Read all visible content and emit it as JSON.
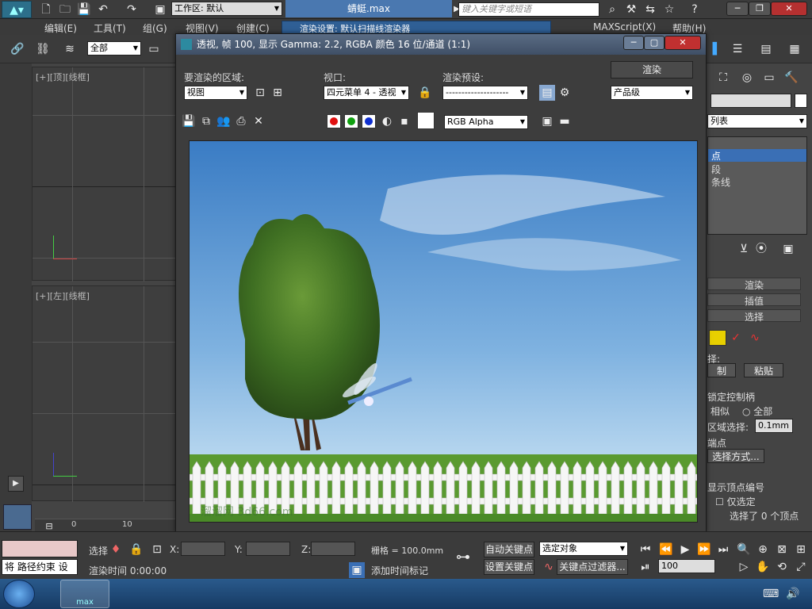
{
  "app": {
    "workspace_label": "工作区: 默认",
    "file_title": "蜻蜓.max",
    "search_placeholder": "键入关键字或短语"
  },
  "menu": [
    "编辑(E)",
    "工具(T)",
    "组(G)",
    "视图(V)",
    "创建(C)",
    "MAXScript(X)",
    "帮助(H)"
  ],
  "toolbar": {
    "selection_filter": "全部"
  },
  "background_dialog_title": "渲染设置: 默认扫描线渲染器",
  "viewports": {
    "top_label": "[+][顶][线框]",
    "left_label": "[+][左][线框]"
  },
  "render_window": {
    "title": "透视, 帧 100, 显示 Gamma: 2.2, RGBA 颜色 16 位/通道 (1:1)",
    "area_label": "要渲染的区域:",
    "area_value": "视图",
    "viewport_label": "视口:",
    "viewport_value": "四元菜单 4 - 透视",
    "preset_label": "渲染预设:",
    "preset_value": "--------------------",
    "render_button": "渲染",
    "quality_value": "产品级",
    "channel_value": "RGB Alpha",
    "watermark": "溜溜网 3d66.com"
  },
  "right_panel": {
    "list_label": "列表",
    "items": [
      "点",
      "段",
      "条线"
    ],
    "rollouts": [
      "渲染",
      "插值",
      "选择"
    ],
    "select_label": "择:",
    "copy_btn": "制",
    "paste_btn": "粘贴",
    "lock_handles": "锁定控制柄",
    "similar": "相似",
    "all": "全部",
    "area_select": "区域选择:",
    "area_value": "0.1mm",
    "endpoint": "端点",
    "select_by": "选择方式...",
    "show_vertex_num": "显示顶点编号",
    "only_selected": "仅选定",
    "selected_count": "选择了 0 个顶点"
  },
  "timeline": {
    "ticks": [
      "0",
      "10"
    ]
  },
  "statusbar": {
    "path_hint": "将 路径约束 设",
    "select_label": "选择",
    "x_label": "X:",
    "y_label": "Y:",
    "z_label": "Z:",
    "grid_text": "栅格 = 100.0mm",
    "render_time": "渲染时间 0:00:00",
    "add_time_tag": "添加时间标记",
    "auto_key": "自动关键点",
    "set_key": "设置关键点",
    "selected_object": "选定对象",
    "key_filters": "关键点过滤器...",
    "frame_value": "100"
  },
  "taskbar": {
    "app_label": "max"
  },
  "colors": {
    "accent": "#3a6fb5",
    "titlebar_blue": "#3a5f8c",
    "red_dot": "#e01010",
    "green_dot": "#10a010",
    "blue_dot": "#1030d0"
  }
}
